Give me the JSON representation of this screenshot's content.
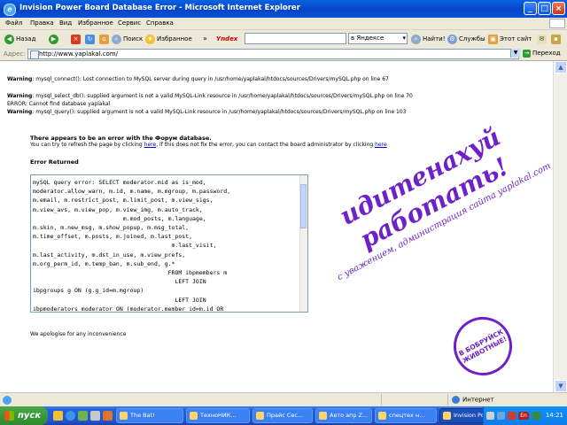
{
  "window": {
    "title": "Invision Power Board Database Error - Microsoft Internet Explorer"
  },
  "menu": [
    "Файл",
    "Правка",
    "Вид",
    "Избранное",
    "Сервис",
    "Справка"
  ],
  "toolbar": {
    "back": "Назад",
    "search": "Поиск",
    "favorites": "Избранное",
    "yandex_logo": "Yndex",
    "search_scope": "в Яндексе",
    "find": "Найти!",
    "services": "Службы",
    "this_site": "Этот сайт"
  },
  "address": {
    "label": "Адрес:",
    "url": "http://www.yaplakal.com/",
    "go": "Переход"
  },
  "page": {
    "warn1_label": "Warning",
    "warn1_text": ": mysql_connect(): Lost connection to MySQL server during query in /usr/home/yaplakal/htdocs/sources/Drivers/mySQL.php on line 67",
    "warn2_label": "Warning",
    "warn2_text": ": mysql_select_db(): supplied argument is not a valid MySQL-Link resource in /usr/home/yaplakal/htdocs/sources/Drivers/mySQL.php on line 70",
    "error_line": "ERROR: Cannot find database yaplakal",
    "warn3_label": "Warning",
    "warn3_text": ": mysql_query(): supplied argument is not a valid MySQL-Link resource in /usr/home/yaplakal/htdocs/sources/Drivers/mySQL.php on line 103",
    "heading": "There appears to be an error with the Форум database.",
    "sub_pre": "You can try to refresh the page by clicking ",
    "sub_link1": "here",
    "sub_mid": ", if this does not fix the error, you can contact the board administrator by clicking ",
    "sub_link2": "here",
    "error_returned": "Error Returned",
    "sql": "mySQL query error: SELECT moderator.mid as is_mod,\nmoderator.allow_warn, m.id, m.name, m.mgroup, m.password,\nm.email, m.restrict_post, m.limit_post, m.view_sigs,\nm.view_avs, m.view_pop, m.view_img, m.auto_track,\n                          m.mod_posts, m.language,\nm.skin, m.new_msg, m.show_popup, m.msg_total,\nm.time_offset, m.posts, m.joined, m.last_post,\n                                        m.last_visit,\nm.last_activity, m.dst_in_use, m.view_prefs,\nm.org_perm_id, m.temp_ban, m.sub_end, g.*\n                                       FROM ibpmembers m\n                                         LEFT JOIN\nibpgroups g ON (g.g_id=m.mgroup)\n                                         LEFT JOIN\nibpmoderators moderator ON (moderator.member_id=m.id OR",
    "apology": "We apologise for any inconvenience"
  },
  "watermark": {
    "line1": "идитенахуй",
    "line2": "работать!",
    "line3": "с уважением, администрация сайта yaplakal.com",
    "stamp": "В БОБРУЙСК ЖИВОТНЫЕ!"
  },
  "status": {
    "zone": "Интернет"
  },
  "taskbar": {
    "start": "пуск",
    "tasks": [
      "The Bat!",
      "ТехноНИК...",
      "Прайс Сес...",
      "Авто апр Z...",
      "спецтех н...",
      "Invision Po..."
    ],
    "lang": "En",
    "clock": "14:21"
  },
  "colors": {
    "accent_purple": "#6d22c9",
    "xp_blue": "#245edb",
    "xp_green": "#3c9a3c"
  }
}
